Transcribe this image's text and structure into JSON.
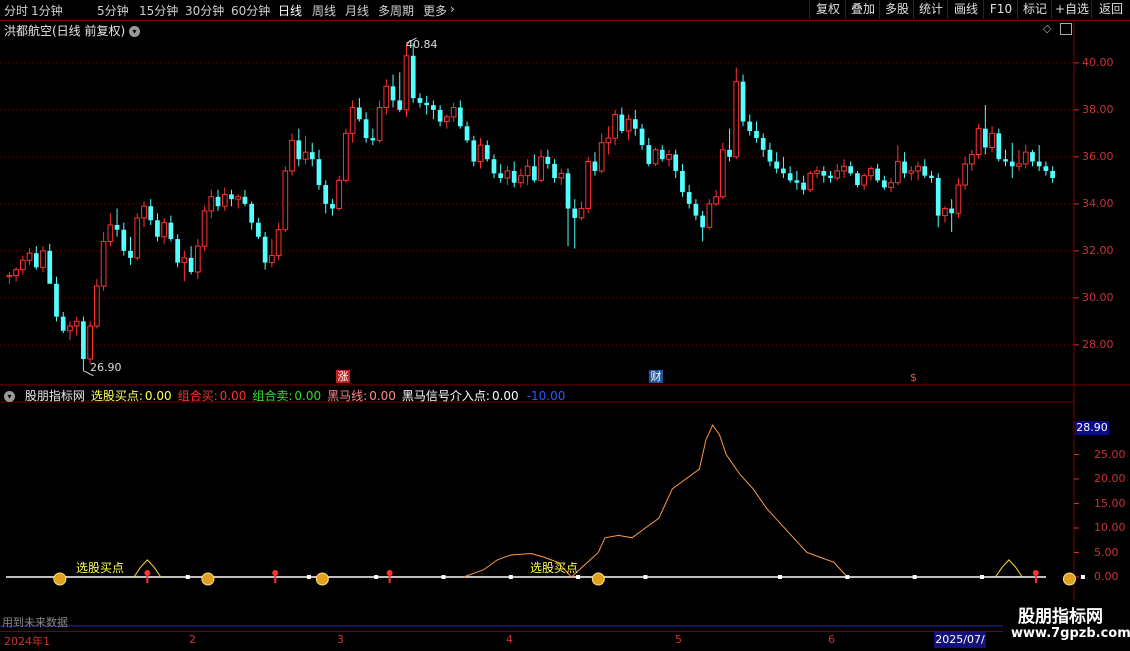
{
  "toolbar": {
    "tabs": [
      "分时",
      "1分钟",
      "5分钟",
      "15分钟",
      "30分钟",
      "60分钟",
      "日线",
      "周线",
      "月线",
      "多周期",
      "更多"
    ],
    "active_tab": "日线",
    "right_buttons": [
      "复权",
      "叠加",
      "多股",
      "统计",
      "画线",
      "F10",
      "标记",
      "+自选",
      "返回"
    ]
  },
  "chart_title": "洪都航空(日线 前复权)",
  "colors": {
    "up": "#ff3232",
    "down": "#54ffff",
    "grid": "#7a0000",
    "axis": "#cc3333"
  },
  "markers": {
    "high_label": "40.84",
    "low_label": "26.90",
    "event_1": "涨",
    "event_2": "财",
    "event_3": "$"
  },
  "indicator": {
    "name": "股朋指标网",
    "items": [
      {
        "label": "选股买点:",
        "value": "0.00",
        "color": "#ffff55"
      },
      {
        "label": "组合买:",
        "value": "0.00",
        "color": "#ff3232"
      },
      {
        "label": "组合卖:",
        "value": "0.00",
        "color": "#33dd33"
      },
      {
        "label": "黑马线:",
        "value": "0.00",
        "color": "#ff8888"
      },
      {
        "label": "黑马信号介入点:",
        "value": "0.00",
        "color": "#ffffff"
      },
      {
        "label": "",
        "value": "-10.00",
        "color": "#3355ff"
      }
    ],
    "current_value": "28.90",
    "buy_label": "选股买点"
  },
  "footer": {
    "future_text": "用到未来数据",
    "end_date": "2025/07/",
    "months": [
      "2024年1",
      "2",
      "3",
      "4",
      "5",
      "6"
    ]
  },
  "watermark": {
    "line1": "股朋指标网",
    "line2": "www.7gpzb.com"
  },
  "chart_data": [
    {
      "type": "candlestick",
      "title": "洪都航空(日线 前复权)",
      "y_ticks": [
        40.0,
        38.0,
        36.0,
        34.0,
        32.0,
        30.0,
        28.0
      ],
      "ylim": [
        26.5,
        41.5
      ],
      "max_point": 40.84,
      "min_point": 26.9,
      "candles": [
        [
          30.9,
          31.1,
          30.6,
          30.95
        ],
        [
          30.95,
          31.3,
          30.7,
          31.2
        ],
        [
          31.2,
          31.8,
          31.0,
          31.6
        ],
        [
          31.6,
          32.1,
          31.4,
          31.9
        ],
        [
          31.9,
          32.2,
          31.2,
          31.3
        ],
        [
          31.3,
          32.2,
          31.1,
          32.0
        ],
        [
          32.0,
          32.3,
          31.0,
          30.6
        ],
        [
          30.6,
          30.9,
          29.0,
          29.2
        ],
        [
          29.2,
          29.4,
          28.5,
          28.6
        ],
        [
          28.6,
          29.0,
          28.2,
          28.8
        ],
        [
          28.8,
          29.2,
          28.4,
          29.0
        ],
        [
          29.0,
          29.2,
          26.9,
          27.4
        ],
        [
          27.4,
          29.0,
          27.2,
          28.8
        ],
        [
          28.8,
          30.8,
          28.7,
          30.5
        ],
        [
          30.5,
          32.8,
          30.3,
          32.4
        ],
        [
          32.4,
          33.6,
          32.2,
          33.1
        ],
        [
          33.1,
          33.8,
          32.6,
          32.9
        ],
        [
          32.9,
          33.2,
          31.8,
          32.0
        ],
        [
          32.0,
          32.6,
          31.4,
          31.7
        ],
        [
          31.7,
          33.6,
          31.6,
          33.4
        ],
        [
          33.4,
          34.1,
          33.0,
          33.9
        ],
        [
          33.9,
          34.2,
          33.1,
          33.3
        ],
        [
          33.3,
          33.6,
          32.4,
          32.6
        ],
        [
          32.6,
          33.4,
          32.3,
          33.2
        ],
        [
          33.2,
          33.5,
          32.4,
          32.5
        ],
        [
          32.5,
          32.7,
          31.3,
          31.5
        ],
        [
          31.5,
          32.0,
          30.7,
          31.7
        ],
        [
          31.7,
          32.2,
          31.0,
          31.1
        ],
        [
          31.1,
          32.5,
          30.8,
          32.2
        ],
        [
          32.2,
          33.9,
          32.0,
          33.7
        ],
        [
          33.7,
          34.6,
          33.4,
          34.3
        ],
        [
          34.3,
          34.6,
          33.7,
          33.9
        ],
        [
          33.9,
          34.7,
          33.7,
          34.4
        ],
        [
          34.4,
          34.6,
          33.9,
          34.2
        ],
        [
          34.2,
          34.4,
          33.8,
          34.3
        ],
        [
          34.3,
          34.6,
          33.9,
          34.0
        ],
        [
          34.0,
          34.1,
          32.9,
          33.2
        ],
        [
          33.2,
          33.4,
          32.5,
          32.6
        ],
        [
          32.6,
          32.8,
          31.2,
          31.5
        ],
        [
          31.5,
          32.5,
          31.3,
          31.8
        ],
        [
          31.8,
          33.2,
          31.6,
          32.9
        ],
        [
          32.9,
          35.6,
          32.8,
          35.4
        ],
        [
          35.4,
          37.0,
          35.2,
          36.7
        ],
        [
          36.7,
          37.2,
          35.6,
          35.9
        ],
        [
          35.9,
          36.9,
          35.7,
          36.2
        ],
        [
          36.2,
          36.6,
          35.6,
          35.9
        ],
        [
          35.9,
          36.3,
          34.6,
          34.8
        ],
        [
          34.8,
          35.0,
          33.6,
          34.0
        ],
        [
          34.0,
          34.2,
          33.5,
          33.8
        ],
        [
          33.8,
          35.2,
          33.7,
          35.0
        ],
        [
          35.0,
          37.2,
          34.9,
          37.0
        ],
        [
          37.0,
          38.4,
          36.6,
          38.1
        ],
        [
          38.1,
          38.5,
          37.5,
          37.6
        ],
        [
          37.6,
          37.9,
          36.6,
          36.8
        ],
        [
          36.8,
          37.2,
          36.5,
          36.7
        ],
        [
          36.7,
          38.4,
          36.6,
          38.1
        ],
        [
          38.1,
          39.3,
          37.8,
          39.0
        ],
        [
          39.0,
          39.5,
          38.1,
          38.4
        ],
        [
          38.4,
          39.6,
          37.9,
          38.0
        ],
        [
          38.0,
          40.84,
          37.7,
          40.3
        ],
        [
          40.3,
          40.84,
          38.3,
          38.5
        ],
        [
          38.5,
          38.7,
          38.1,
          38.3
        ],
        [
          38.3,
          38.6,
          37.8,
          38.2
        ],
        [
          38.2,
          38.4,
          37.6,
          38.0
        ],
        [
          38.0,
          38.2,
          37.3,
          37.5
        ],
        [
          37.5,
          37.8,
          37.2,
          37.7
        ],
        [
          37.7,
          38.3,
          37.5,
          38.1
        ],
        [
          38.1,
          38.4,
          37.2,
          37.3
        ],
        [
          37.3,
          37.5,
          36.6,
          36.7
        ],
        [
          36.7,
          36.9,
          35.6,
          35.8
        ],
        [
          35.8,
          36.8,
          35.5,
          36.5
        ],
        [
          36.5,
          36.7,
          35.8,
          35.9
        ],
        [
          35.9,
          36.1,
          35.1,
          35.3
        ],
        [
          35.3,
          35.7,
          34.9,
          35.1
        ],
        [
          35.1,
          35.6,
          34.8,
          35.4
        ],
        [
          35.4,
          35.8,
          34.7,
          34.9
        ],
        [
          34.9,
          35.5,
          34.7,
          35.2
        ],
        [
          35.2,
          35.9,
          34.8,
          35.6
        ],
        [
          35.6,
          36.1,
          34.9,
          35.0
        ],
        [
          35.0,
          36.3,
          34.9,
          36.0
        ],
        [
          36.0,
          36.3,
          35.5,
          35.7
        ],
        [
          35.7,
          35.9,
          34.9,
          35.1
        ],
        [
          35.1,
          35.5,
          34.8,
          35.3
        ],
        [
          35.3,
          35.5,
          32.2,
          33.8
        ],
        [
          33.8,
          34.2,
          32.1,
          33.4
        ],
        [
          33.4,
          34.1,
          33.3,
          33.8
        ],
        [
          33.8,
          36.0,
          33.6,
          35.8
        ],
        [
          35.8,
          36.2,
          35.2,
          35.4
        ],
        [
          35.4,
          37.0,
          35.3,
          36.6
        ],
        [
          36.6,
          37.3,
          36.1,
          36.8
        ],
        [
          36.8,
          38.0,
          36.5,
          37.8
        ],
        [
          37.8,
          38.1,
          37.0,
          37.1
        ],
        [
          37.1,
          37.8,
          36.7,
          37.6
        ],
        [
          37.6,
          38.0,
          36.9,
          37.2
        ],
        [
          37.2,
          37.4,
          36.3,
          36.5
        ],
        [
          36.5,
          36.8,
          35.6,
          35.7
        ],
        [
          35.7,
          36.4,
          35.6,
          36.3
        ],
        [
          36.3,
          36.5,
          35.8,
          35.9
        ],
        [
          35.9,
          36.3,
          35.6,
          36.1
        ],
        [
          36.1,
          36.3,
          35.1,
          35.4
        ],
        [
          35.4,
          35.7,
          34.3,
          34.5
        ],
        [
          34.5,
          34.8,
          33.8,
          34.0
        ],
        [
          34.0,
          34.2,
          33.3,
          33.5
        ],
        [
          33.5,
          33.7,
          32.4,
          33.0
        ],
        [
          33.0,
          34.2,
          32.9,
          34.0
        ],
        [
          34.0,
          34.6,
          33.9,
          34.3
        ],
        [
          34.3,
          36.6,
          34.2,
          36.3
        ],
        [
          36.3,
          37.2,
          35.8,
          36.0
        ],
        [
          36.0,
          39.8,
          35.9,
          39.2
        ],
        [
          39.2,
          39.5,
          37.3,
          37.5
        ],
        [
          37.5,
          37.8,
          36.9,
          37.1
        ],
        [
          37.1,
          37.5,
          36.6,
          36.8
        ],
        [
          36.8,
          37.0,
          36.0,
          36.3
        ],
        [
          36.3,
          36.6,
          35.6,
          35.8
        ],
        [
          35.8,
          36.2,
          35.3,
          35.5
        ],
        [
          35.5,
          36.0,
          35.1,
          35.3
        ],
        [
          35.3,
          35.6,
          34.9,
          35.0
        ],
        [
          35.0,
          35.4,
          34.6,
          34.9
        ],
        [
          34.9,
          35.2,
          34.4,
          34.6
        ],
        [
          34.6,
          35.4,
          34.5,
          35.3
        ],
        [
          35.3,
          35.6,
          35.1,
          35.4
        ],
        [
          35.4,
          35.6,
          34.9,
          35.2
        ],
        [
          35.2,
          35.4,
          34.9,
          35.1
        ],
        [
          35.1,
          35.7,
          35.0,
          35.4
        ],
        [
          35.4,
          35.9,
          35.1,
          35.6
        ],
        [
          35.6,
          35.8,
          35.2,
          35.3
        ],
        [
          35.3,
          35.4,
          34.7,
          34.8
        ],
        [
          34.8,
          35.3,
          34.6,
          35.2
        ],
        [
          35.2,
          35.6,
          35.0,
          35.5
        ],
        [
          35.5,
          35.7,
          34.9,
          35.0
        ],
        [
          35.0,
          35.2,
          34.6,
          34.7
        ],
        [
          34.7,
          35.1,
          34.5,
          34.9
        ],
        [
          34.9,
          36.5,
          34.8,
          35.8
        ],
        [
          35.8,
          36.2,
          35.1,
          35.3
        ],
        [
          35.3,
          35.6,
          35.0,
          35.4
        ],
        [
          35.4,
          35.8,
          35.0,
          35.6
        ],
        [
          35.6,
          35.9,
          35.1,
          35.2
        ],
        [
          35.2,
          35.4,
          34.9,
          35.1
        ],
        [
          35.1,
          35.3,
          33.0,
          33.5
        ],
        [
          33.5,
          33.9,
          33.2,
          33.8
        ],
        [
          33.8,
          34.2,
          32.8,
          33.6
        ],
        [
          33.6,
          35.1,
          33.4,
          34.8
        ],
        [
          34.8,
          36.0,
          34.6,
          35.7
        ],
        [
          35.7,
          36.3,
          35.4,
          36.1
        ],
        [
          36.1,
          37.4,
          35.9,
          37.2
        ],
        [
          37.2,
          38.2,
          36.1,
          36.4
        ],
        [
          36.4,
          37.3,
          36.2,
          37.0
        ],
        [
          37.0,
          37.2,
          35.8,
          35.9
        ],
        [
          35.9,
          36.3,
          35.6,
          35.8
        ],
        [
          35.8,
          36.6,
          35.1,
          35.6
        ],
        [
          35.6,
          36.3,
          35.4,
          35.7
        ],
        [
          35.7,
          36.5,
          35.5,
          36.2
        ],
        [
          36.2,
          36.3,
          35.6,
          35.8
        ],
        [
          35.8,
          36.5,
          35.4,
          35.6
        ],
        [
          35.6,
          35.8,
          35.2,
          35.4
        ],
        [
          35.4,
          35.6,
          34.9,
          35.1
        ]
      ]
    },
    {
      "type": "line",
      "title": "股朋指标网",
      "y_ticks": [
        25.0,
        20.0,
        15.0,
        10.0,
        5.0,
        0.0
      ],
      "ylim": [
        -0.5,
        31
      ],
      "series": [
        {
          "name": "黑马线",
          "points": [
            [
              68,
              0
            ],
            [
              71,
              1.5
            ],
            [
              73,
              3.5
            ],
            [
              75,
              4.5
            ],
            [
              78,
              4.8
            ],
            [
              80,
              4
            ],
            [
              82,
              3
            ],
            [
              84,
              0
            ],
            [
              86,
              2.5
            ],
            [
              88,
              5
            ],
            [
              89,
              8
            ],
            [
              91,
              8.5
            ],
            [
              93,
              8
            ],
            [
              95,
              10
            ],
            [
              97,
              12
            ],
            [
              99,
              18
            ],
            [
              101,
              20
            ],
            [
              103,
              22
            ],
            [
              104,
              28
            ],
            [
              105,
              31
            ],
            [
              106,
              29
            ],
            [
              107,
              25
            ],
            [
              109,
              21
            ],
            [
              111,
              18
            ],
            [
              113,
              14
            ],
            [
              115,
              11
            ],
            [
              117,
              8
            ],
            [
              119,
              5
            ],
            [
              121,
              4
            ],
            [
              123,
              3
            ],
            [
              125,
              0
            ]
          ]
        },
        {
          "name": "选股买点",
          "points": [
            [
              19,
              0
            ],
            [
              20,
              2
            ],
            [
              21,
              3.5
            ],
            [
              22,
              2
            ],
            [
              23,
              0
            ]
          ]
        },
        {
          "name": "选股买点",
          "points": [
            [
              147,
              0
            ],
            [
              148,
              2
            ],
            [
              149,
              3.5
            ],
            [
              150,
              2
            ],
            [
              151,
              0
            ]
          ]
        },
        {
          "name": "组合卖",
          "points": [
            [
              197,
              0
            ],
            [
              199,
              2
            ],
            [
              200,
              3.2
            ],
            [
              201,
              2
            ],
            [
              203,
              0.5
            ],
            [
              204,
              0
            ]
          ]
        }
      ]
    }
  ]
}
